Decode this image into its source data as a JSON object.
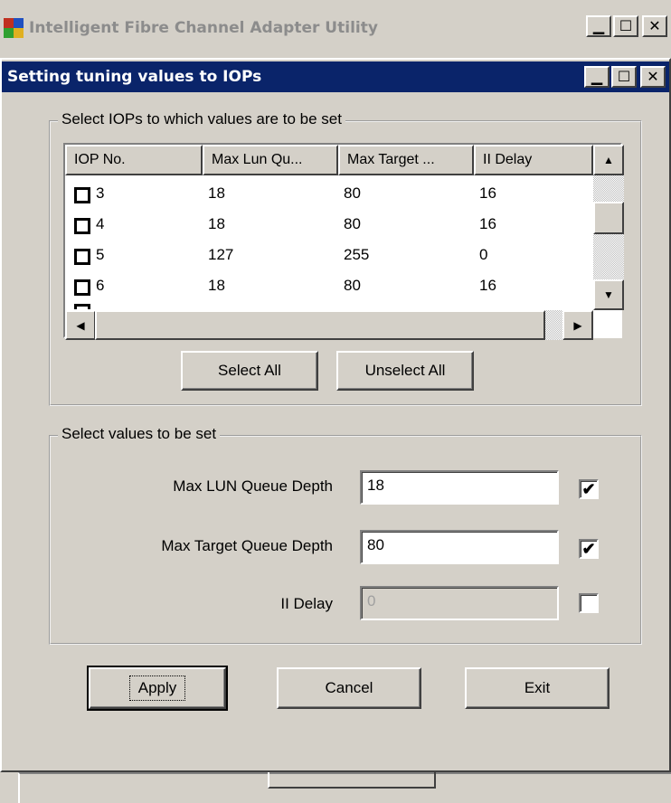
{
  "app_window": {
    "title": "Intelligent Fibre Channel Adapter Utility"
  },
  "dialog": {
    "title": "Setting tuning values to IOPs"
  },
  "iop_group": {
    "legend": "Select IOPs to which values are to be set",
    "columns": [
      "IOP No.",
      "Max Lun Qu...",
      "Max Target ...",
      "II Delay"
    ],
    "rows": [
      {
        "iop": "3",
        "max_lun": "18",
        "max_target": "80",
        "ii_delay": "16",
        "checked": false
      },
      {
        "iop": "4",
        "max_lun": "18",
        "max_target": "80",
        "ii_delay": "16",
        "checked": false
      },
      {
        "iop": "5",
        "max_lun": "127",
        "max_target": "255",
        "ii_delay": "0",
        "checked": false
      },
      {
        "iop": "6",
        "max_lun": "18",
        "max_target": "80",
        "ii_delay": "16",
        "checked": false
      }
    ],
    "select_all_label": "Select All",
    "unselect_all_label": "Unselect All"
  },
  "values_group": {
    "legend": "Select values to be set",
    "fields": [
      {
        "label": "Max LUN Queue Depth",
        "value": "18",
        "checked": true,
        "enabled": true
      },
      {
        "label": "Max Target Queue Depth",
        "value": "80",
        "checked": true,
        "enabled": true
      },
      {
        "label": "II Delay",
        "value": "0",
        "checked": false,
        "enabled": false
      }
    ]
  },
  "buttons": {
    "apply": "Apply",
    "cancel": "Cancel",
    "exit": "Exit"
  },
  "icons": {
    "minimize": "minimize-icon",
    "maximize": "maximize-icon",
    "close": "close-icon",
    "app": "app-icon",
    "check": "check-icon"
  },
  "colors": {
    "title_active": "#0a246a",
    "title_inactive_text": "#8c8c8c",
    "face": "#d4d0c8"
  }
}
